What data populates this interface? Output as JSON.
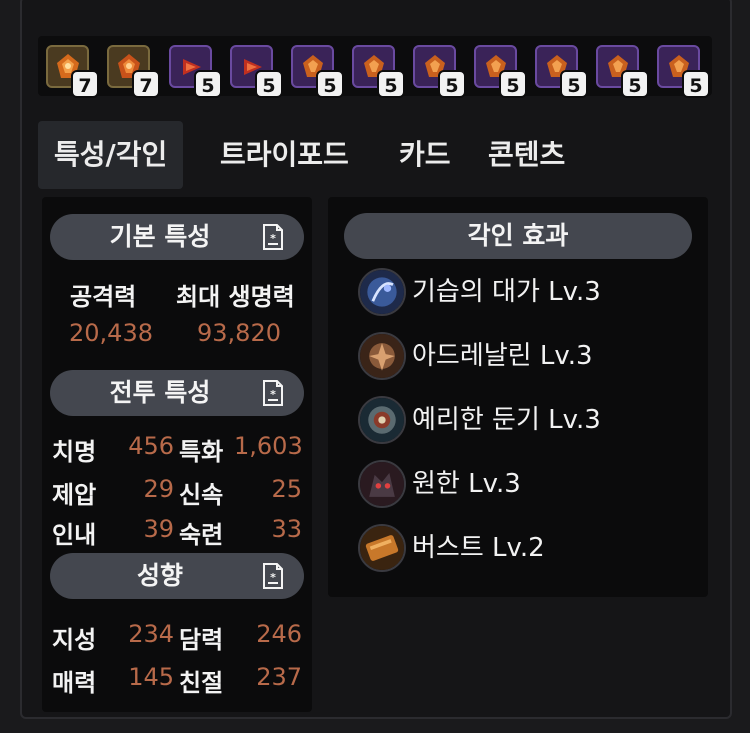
{
  "gems": [
    {
      "level": "7",
      "kind": "orange-gem-icon",
      "tier": "legendary"
    },
    {
      "level": "7",
      "kind": "orange-gem-icon",
      "tier": "legendary"
    },
    {
      "level": "5",
      "kind": "red-gem-icon",
      "tier": "epic"
    },
    {
      "level": "5",
      "kind": "red-gem-icon",
      "tier": "epic"
    },
    {
      "level": "5",
      "kind": "orange-gem-icon",
      "tier": "epic"
    },
    {
      "level": "5",
      "kind": "orange-gem-icon",
      "tier": "epic"
    },
    {
      "level": "5",
      "kind": "orange-gem-icon",
      "tier": "epic"
    },
    {
      "level": "5",
      "kind": "orange-gem-icon",
      "tier": "epic"
    },
    {
      "level": "5",
      "kind": "orange-gem-icon",
      "tier": "epic"
    },
    {
      "level": "5",
      "kind": "orange-gem-icon",
      "tier": "epic"
    },
    {
      "level": "5",
      "kind": "orange-gem-icon",
      "tier": "epic"
    }
  ],
  "tabs": [
    "특성/각인",
    "트라이포드",
    "카드",
    "콘텐츠"
  ],
  "basic": {
    "title": "기본 특성",
    "attack_label": "공격력",
    "hp_label": "최대 생명력",
    "attack_value": "20,438",
    "hp_value": "93,820"
  },
  "combat": {
    "title": "전투 특성",
    "rows": [
      {
        "left_name": "치명",
        "left_value": "456",
        "right_name": "특화",
        "right_value": "1,603"
      },
      {
        "left_name": "제압",
        "left_value": "29",
        "right_name": "신속",
        "right_value": "25"
      },
      {
        "left_name": "인내",
        "left_value": "39",
        "right_name": "숙련",
        "right_value": "33"
      }
    ]
  },
  "tendency": {
    "title": "성향",
    "rows": [
      {
        "left_name": "지성",
        "left_value": "234",
        "right_name": "담력",
        "right_value": "246"
      },
      {
        "left_name": "매력",
        "left_value": "145",
        "right_name": "친절",
        "right_value": "237"
      }
    ]
  },
  "engravings": {
    "title": "각인 효과",
    "items": [
      {
        "label": "기습의 대가 Lv.3",
        "icon": "ambush-master-icon"
      },
      {
        "label": "아드레날린 Lv.3",
        "icon": "adrenaline-icon"
      },
      {
        "label": "예리한 둔기 Lv.3",
        "icon": "keen-blunt-weapon-icon"
      },
      {
        "label": "원한 Lv.3",
        "icon": "grudge-icon"
      },
      {
        "label": "버스트 Lv.2",
        "icon": "burst-icon"
      }
    ]
  },
  "colors": {
    "accent_value": "#b86a4a",
    "pill_bg": "#44474f",
    "panel_bg": "#0b0b0c"
  }
}
